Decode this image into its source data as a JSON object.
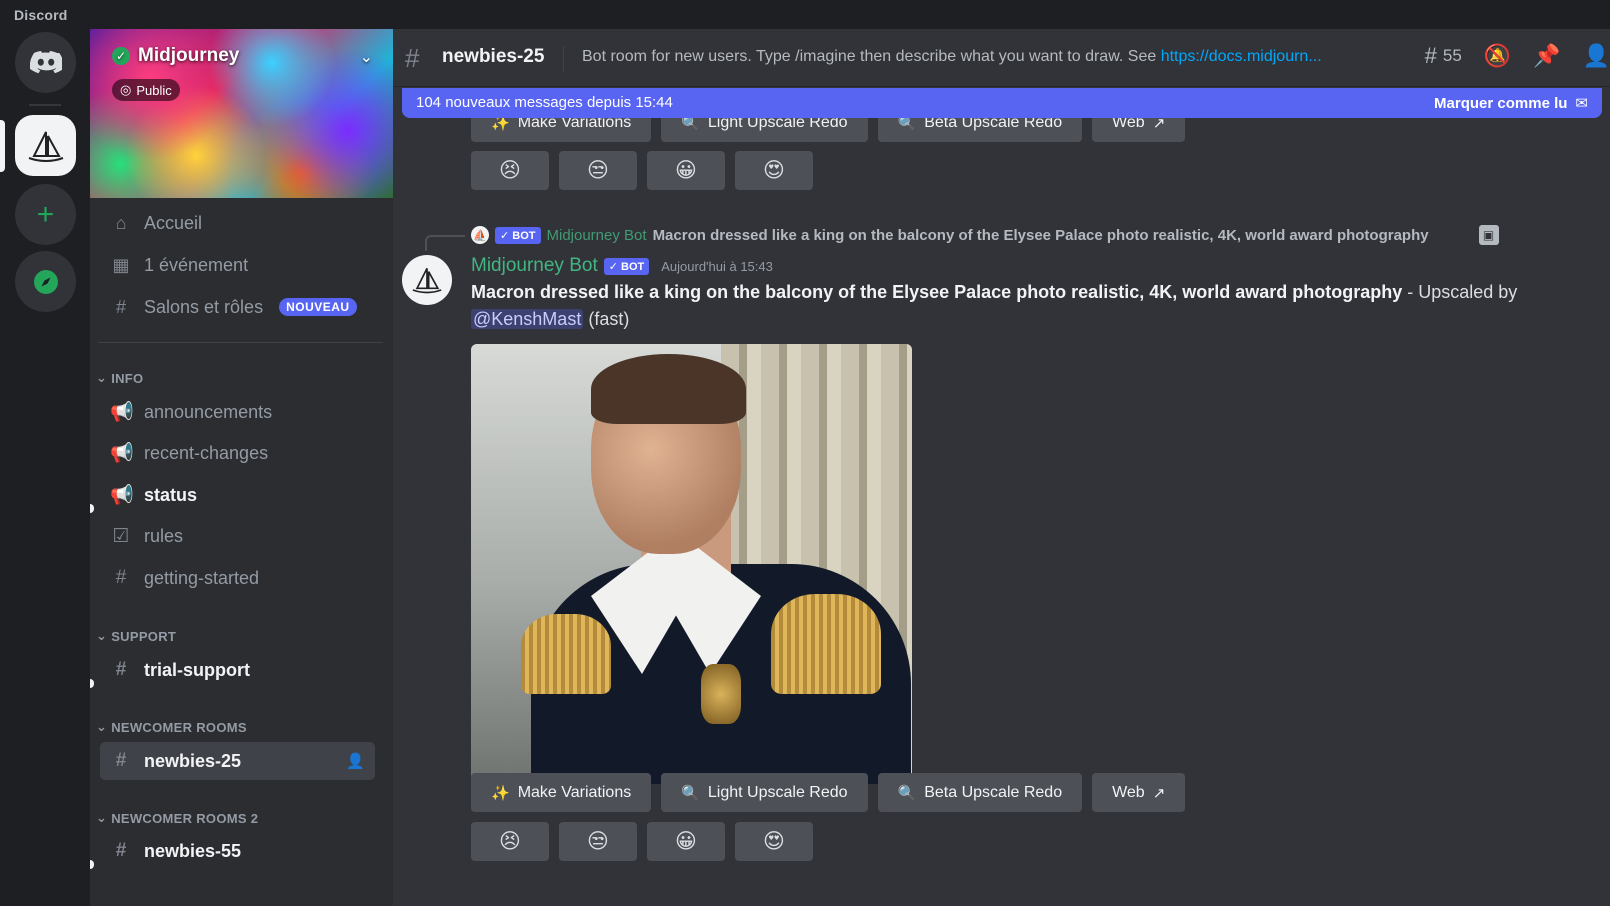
{
  "window": {
    "app_name": "Discord"
  },
  "server": {
    "name": "Midjourney",
    "visibility": "Public",
    "nav": [
      {
        "label": "Accueil",
        "icon": "home-icon"
      },
      {
        "label": "1 événement",
        "icon": "calendar-icon"
      },
      {
        "label": "Salons et rôles",
        "icon": "channels-roles-icon",
        "badge": "NOUVEAU"
      }
    ],
    "categories": [
      {
        "name": "INFO",
        "channels": [
          {
            "label": "announcements",
            "icon": "megaphone-icon"
          },
          {
            "label": "recent-changes",
            "icon": "megaphone-icon"
          },
          {
            "label": "status",
            "icon": "megaphone-icon",
            "unread": true
          },
          {
            "label": "rules",
            "icon": "checkbox-icon"
          },
          {
            "label": "getting-started",
            "icon": "hash-icon"
          }
        ]
      },
      {
        "name": "SUPPORT",
        "channels": [
          {
            "label": "trial-support",
            "icon": "hash-icon",
            "unread": true
          }
        ]
      },
      {
        "name": "NEWCOMER ROOMS",
        "channels": [
          {
            "label": "newbies-25",
            "icon": "hash-thread-icon",
            "active": true
          }
        ]
      },
      {
        "name": "NEWCOMER ROOMS 2",
        "channels": [
          {
            "label": "newbies-55",
            "icon": "hash-thread-icon",
            "unread": true
          }
        ]
      }
    ]
  },
  "header": {
    "channel": "newbies-25",
    "topic": "Bot room for new users. Type /imagine then describe what you want to draw. See ",
    "topic_link": "https://docs.midjourn...",
    "thread_count": "55"
  },
  "new_messages": {
    "text": "104 nouveaux messages depuis 15:44",
    "action": "Marquer comme lu"
  },
  "buttons": {
    "make_variations": "Make Variations",
    "light_upscale": "Light Upscale Redo",
    "beta_upscale": "Beta Upscale Redo",
    "web": "Web"
  },
  "reactions": [
    "😣",
    "😒",
    "😀",
    "😍"
  ],
  "reply": {
    "author": "Midjourney Bot",
    "tag": "✓ BOT",
    "text": "Macron dressed like a king on the balcony of the Elysee Palace photo realistic, 4K, world award photography"
  },
  "message": {
    "author": "Midjourney Bot",
    "tag": "✓ BOT",
    "timestamp": "Aujourd'hui à 15:43",
    "prompt": "Macron dressed like a king on the balcony of the Elysee Palace photo realistic, 4K, world award photography",
    "suffix": " - Upscaled by ",
    "mention": "@KenshMast",
    "speed": " (fast)"
  },
  "colors": {
    "accent": "#5865f2",
    "bot_name": "#43b581",
    "link": "#00a8fc"
  }
}
